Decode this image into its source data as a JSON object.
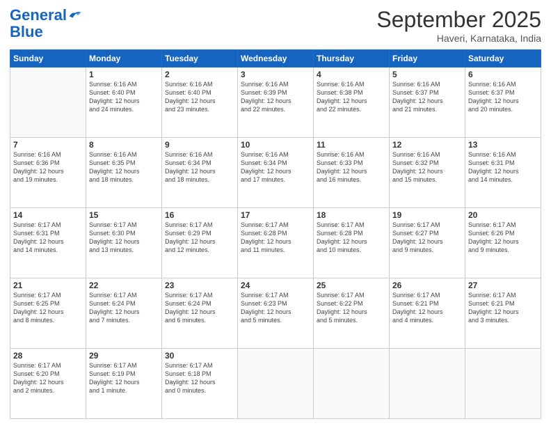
{
  "logo": {
    "line1": "General",
    "line2": "Blue"
  },
  "header": {
    "month": "September 2025",
    "location": "Haveri, Karnataka, India"
  },
  "weekdays": [
    "Sunday",
    "Monday",
    "Tuesday",
    "Wednesday",
    "Thursday",
    "Friday",
    "Saturday"
  ],
  "weeks": [
    [
      {
        "day": "",
        "info": ""
      },
      {
        "day": "1",
        "info": "Sunrise: 6:16 AM\nSunset: 6:40 PM\nDaylight: 12 hours\nand 24 minutes."
      },
      {
        "day": "2",
        "info": "Sunrise: 6:16 AM\nSunset: 6:40 PM\nDaylight: 12 hours\nand 23 minutes."
      },
      {
        "day": "3",
        "info": "Sunrise: 6:16 AM\nSunset: 6:39 PM\nDaylight: 12 hours\nand 22 minutes."
      },
      {
        "day": "4",
        "info": "Sunrise: 6:16 AM\nSunset: 6:38 PM\nDaylight: 12 hours\nand 22 minutes."
      },
      {
        "day": "5",
        "info": "Sunrise: 6:16 AM\nSunset: 6:37 PM\nDaylight: 12 hours\nand 21 minutes."
      },
      {
        "day": "6",
        "info": "Sunrise: 6:16 AM\nSunset: 6:37 PM\nDaylight: 12 hours\nand 20 minutes."
      }
    ],
    [
      {
        "day": "7",
        "info": "Sunrise: 6:16 AM\nSunset: 6:36 PM\nDaylight: 12 hours\nand 19 minutes."
      },
      {
        "day": "8",
        "info": "Sunrise: 6:16 AM\nSunset: 6:35 PM\nDaylight: 12 hours\nand 18 minutes."
      },
      {
        "day": "9",
        "info": "Sunrise: 6:16 AM\nSunset: 6:34 PM\nDaylight: 12 hours\nand 18 minutes."
      },
      {
        "day": "10",
        "info": "Sunrise: 6:16 AM\nSunset: 6:34 PM\nDaylight: 12 hours\nand 17 minutes."
      },
      {
        "day": "11",
        "info": "Sunrise: 6:16 AM\nSunset: 6:33 PM\nDaylight: 12 hours\nand 16 minutes."
      },
      {
        "day": "12",
        "info": "Sunrise: 6:16 AM\nSunset: 6:32 PM\nDaylight: 12 hours\nand 15 minutes."
      },
      {
        "day": "13",
        "info": "Sunrise: 6:16 AM\nSunset: 6:31 PM\nDaylight: 12 hours\nand 14 minutes."
      }
    ],
    [
      {
        "day": "14",
        "info": "Sunrise: 6:17 AM\nSunset: 6:31 PM\nDaylight: 12 hours\nand 14 minutes."
      },
      {
        "day": "15",
        "info": "Sunrise: 6:17 AM\nSunset: 6:30 PM\nDaylight: 12 hours\nand 13 minutes."
      },
      {
        "day": "16",
        "info": "Sunrise: 6:17 AM\nSunset: 6:29 PM\nDaylight: 12 hours\nand 12 minutes."
      },
      {
        "day": "17",
        "info": "Sunrise: 6:17 AM\nSunset: 6:28 PM\nDaylight: 12 hours\nand 11 minutes."
      },
      {
        "day": "18",
        "info": "Sunrise: 6:17 AM\nSunset: 6:28 PM\nDaylight: 12 hours\nand 10 minutes."
      },
      {
        "day": "19",
        "info": "Sunrise: 6:17 AM\nSunset: 6:27 PM\nDaylight: 12 hours\nand 9 minutes."
      },
      {
        "day": "20",
        "info": "Sunrise: 6:17 AM\nSunset: 6:26 PM\nDaylight: 12 hours\nand 9 minutes."
      }
    ],
    [
      {
        "day": "21",
        "info": "Sunrise: 6:17 AM\nSunset: 6:25 PM\nDaylight: 12 hours\nand 8 minutes."
      },
      {
        "day": "22",
        "info": "Sunrise: 6:17 AM\nSunset: 6:24 PM\nDaylight: 12 hours\nand 7 minutes."
      },
      {
        "day": "23",
        "info": "Sunrise: 6:17 AM\nSunset: 6:24 PM\nDaylight: 12 hours\nand 6 minutes."
      },
      {
        "day": "24",
        "info": "Sunrise: 6:17 AM\nSunset: 6:23 PM\nDaylight: 12 hours\nand 5 minutes."
      },
      {
        "day": "25",
        "info": "Sunrise: 6:17 AM\nSunset: 6:22 PM\nDaylight: 12 hours\nand 5 minutes."
      },
      {
        "day": "26",
        "info": "Sunrise: 6:17 AM\nSunset: 6:21 PM\nDaylight: 12 hours\nand 4 minutes."
      },
      {
        "day": "27",
        "info": "Sunrise: 6:17 AM\nSunset: 6:21 PM\nDaylight: 12 hours\nand 3 minutes."
      }
    ],
    [
      {
        "day": "28",
        "info": "Sunrise: 6:17 AM\nSunset: 6:20 PM\nDaylight: 12 hours\nand 2 minutes."
      },
      {
        "day": "29",
        "info": "Sunrise: 6:17 AM\nSunset: 6:19 PM\nDaylight: 12 hours\nand 1 minute."
      },
      {
        "day": "30",
        "info": "Sunrise: 6:17 AM\nSunset: 6:18 PM\nDaylight: 12 hours\nand 0 minutes."
      },
      {
        "day": "",
        "info": ""
      },
      {
        "day": "",
        "info": ""
      },
      {
        "day": "",
        "info": ""
      },
      {
        "day": "",
        "info": ""
      }
    ]
  ]
}
